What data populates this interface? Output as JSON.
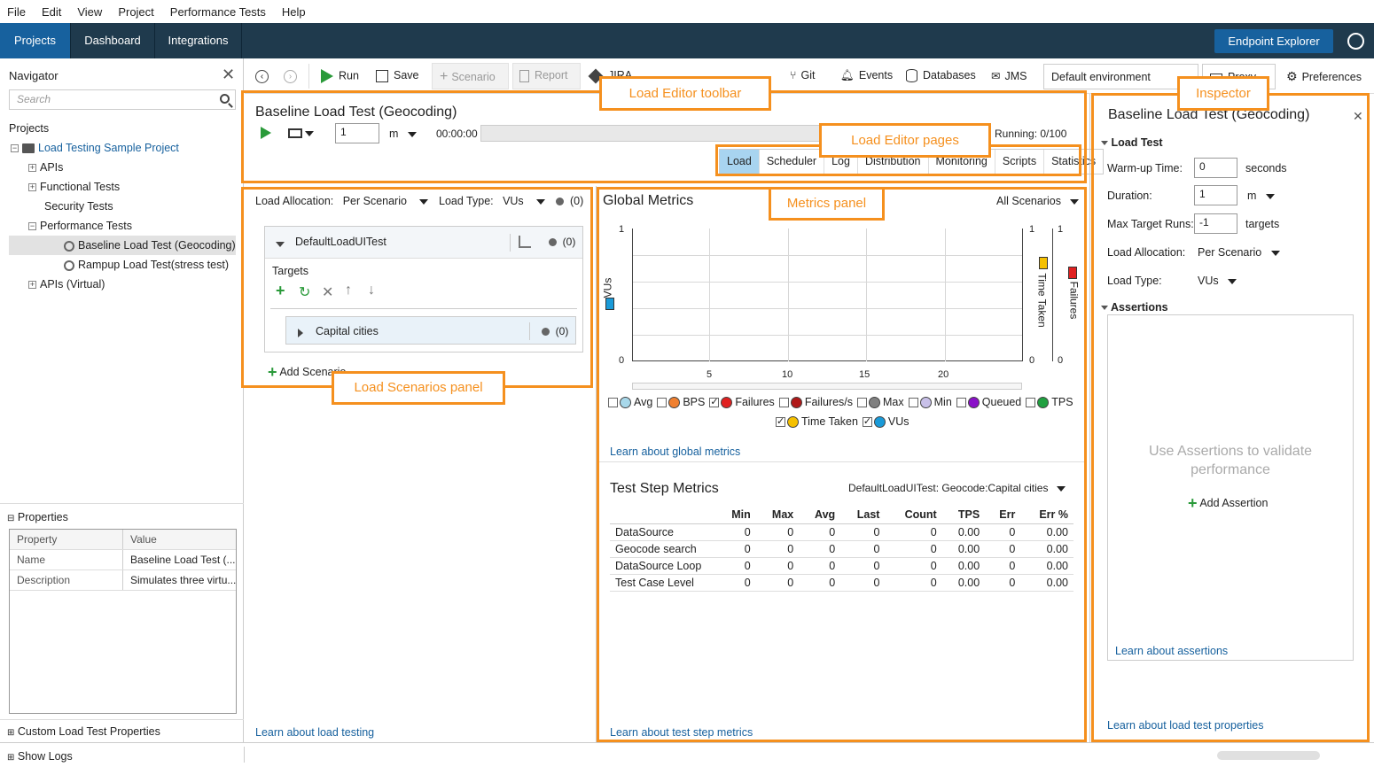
{
  "menu": [
    "File",
    "Edit",
    "View",
    "Project",
    "Performance Tests",
    "Help"
  ],
  "topnav": {
    "tabs": [
      "Projects",
      "Dashboard",
      "Integrations"
    ],
    "endpoint_explorer": "Endpoint Explorer"
  },
  "navigator": {
    "title": "Navigator",
    "search_placeholder": "Search",
    "projects_label": "Projects",
    "project_name": "Load Testing Sample Project",
    "items": [
      "APIs",
      "Functional Tests",
      "Security Tests",
      "Performance Tests",
      "Baseline Load Test (Geocoding)",
      "Rampup Load Test(stress test)",
      "APIs (Virtual)"
    ],
    "properties_label": "Properties",
    "prop_headers": [
      "Property",
      "Value"
    ],
    "props": [
      [
        "Name",
        "Baseline Load Test (..."
      ],
      [
        "Description",
        "Simulates three virtu..."
      ]
    ],
    "custom_props": "Custom Load Test Properties",
    "show_logs": "Show Logs"
  },
  "toolbar": {
    "run": "Run",
    "save": "Save",
    "scenario": "Scenario",
    "report": "Report",
    "jira": "JIRA",
    "git": "Git",
    "events": "Events",
    "databases": "Databases",
    "jms": "JMS",
    "environment": "Default environment",
    "proxy": "Proxy",
    "preferences": "Preferences"
  },
  "editor": {
    "title": "Baseline Load Test (Geocoding)",
    "duration_value": "1",
    "duration_unit": "m",
    "timer": "00:00:00",
    "running": "Running: 0/100",
    "pages": [
      "Load",
      "Scheduler",
      "Log",
      "Distribution",
      "Monitoring",
      "Scripts",
      "Statistics"
    ]
  },
  "callouts": {
    "toolbar": "Load Editor toolbar",
    "pages": "Load Editor pages",
    "metrics": "Metrics panel",
    "scenarios": "Load Scenarios panel",
    "inspector": "Inspector"
  },
  "scenarios": {
    "allocation_label": "Load Allocation:",
    "allocation_value": "Per Scenario",
    "type_label": "Load Type:",
    "type_value": "VUs",
    "count": "(0)",
    "scenario_name": "DefaultLoadUITest",
    "scenario_count": "(0)",
    "targets_label": "Targets",
    "target_name": "Capital cities",
    "target_count": "(0)",
    "add_scenario": "Add Scenario",
    "learn": "Learn about load testing"
  },
  "global_metrics": {
    "title": "Global Metrics",
    "filter": "All Scenarios",
    "y_left_label": "VUs",
    "y_right1_label": "Time Taken",
    "y_right2_label": "Failures",
    "y_left_ticks": [
      "1",
      "0"
    ],
    "y_right_ticks": [
      "1",
      "0"
    ],
    "x_ticks": [
      "5",
      "10",
      "15",
      "20"
    ],
    "legend": [
      {
        "name": "Avg",
        "checked": false,
        "color": "#a8d8ea"
      },
      {
        "name": "BPS",
        "checked": false,
        "color": "#f08030"
      },
      {
        "name": "Failures",
        "checked": true,
        "color": "#e02020"
      },
      {
        "name": "Failures/s",
        "checked": false,
        "color": "#b01818"
      },
      {
        "name": "Max",
        "checked": false,
        "color": "#808080"
      },
      {
        "name": "Min",
        "checked": false,
        "color": "#c8c0e8"
      },
      {
        "name": "Queued",
        "checked": false,
        "color": "#8a10c8"
      },
      {
        "name": "TPS",
        "checked": false,
        "color": "#20a040"
      },
      {
        "name": "Time Taken",
        "checked": true,
        "color": "#f5c000"
      },
      {
        "name": "VUs",
        "checked": true,
        "color": "#1a9ad8"
      }
    ],
    "learn": "Learn about global metrics"
  },
  "test_step_metrics": {
    "title": "Test Step Metrics",
    "filter": "DefaultLoadUITest: Geocode:Capital cities",
    "columns": [
      "",
      "Min",
      "Max",
      "Avg",
      "Last",
      "Count",
      "TPS",
      "Err",
      "Err %"
    ],
    "rows": [
      [
        "DataSource",
        "0",
        "0",
        "0",
        "0",
        "0",
        "0.00",
        "0",
        "0.00"
      ],
      [
        "Geocode search",
        "0",
        "0",
        "0",
        "0",
        "0",
        "0.00",
        "0",
        "0.00"
      ],
      [
        "DataSource Loop",
        "0",
        "0",
        "0",
        "0",
        "0",
        "0.00",
        "0",
        "0.00"
      ],
      [
        "Test Case Level",
        "0",
        "0",
        "0",
        "0",
        "0",
        "0.00",
        "0",
        "0.00"
      ]
    ],
    "learn": "Learn about test step metrics"
  },
  "inspector": {
    "title": "Baseline Load Test (Geocoding)",
    "section": "Load Test",
    "warmup_label": "Warm-up Time:",
    "warmup_value": "0",
    "warmup_unit": "seconds",
    "duration_label": "Duration:",
    "duration_value": "1",
    "duration_unit": "m",
    "max_runs_label": "Max Target Runs:",
    "max_runs_value": "-1",
    "max_runs_unit": "targets",
    "alloc_label": "Load Allocation:",
    "alloc_value": "Per Scenario",
    "type_label": "Load Type:",
    "type_value": "VUs",
    "assertions": "Assertions",
    "assert_hint": "Use Assertions to validate performance",
    "add_assertion": "Add Assertion",
    "learn_assertions": "Learn about assertions",
    "learn_props": "Learn about load test properties"
  }
}
